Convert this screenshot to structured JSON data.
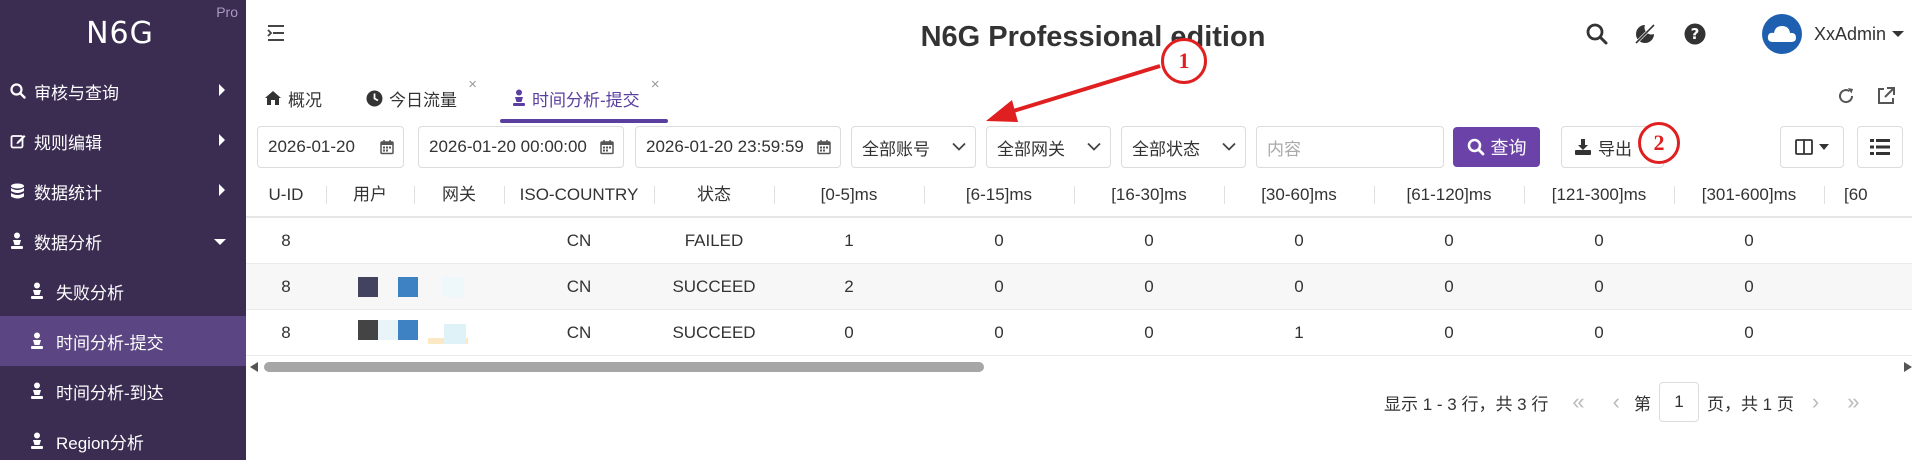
{
  "app": {
    "logo": "N6G",
    "edition_badge": "Pro",
    "title": "N6G Professional edition"
  },
  "sidebar": {
    "items": [
      {
        "label": "审核与查询",
        "icon": "search-icon"
      },
      {
        "label": "规则编辑",
        "icon": "edit-icon"
      },
      {
        "label": "数据统计",
        "icon": "database-icon"
      },
      {
        "label": "数据分析",
        "icon": "user-analysis-icon",
        "expanded": true
      }
    ],
    "sub_items": [
      {
        "label": "失败分析"
      },
      {
        "label": "时间分析-提交",
        "active": true
      },
      {
        "label": "时间分析-到达"
      },
      {
        "label": "Region分析"
      }
    ]
  },
  "header": {
    "username": "XxAdmin"
  },
  "tabs": [
    {
      "label": "概况",
      "icon": "home-icon"
    },
    {
      "label": "今日流量",
      "icon": "clock-icon",
      "closable": true
    },
    {
      "label": "时间分析-提交",
      "icon": "user-analysis-icon",
      "closable": true,
      "active": true
    }
  ],
  "filters": {
    "date": "2026-01-20",
    "start_time": "2026-01-20 00:00:00",
    "end_time": "2026-01-20 23:59:59",
    "account": "全部账号",
    "gateway": "全部网关",
    "status": "全部状态",
    "content_placeholder": "内容",
    "query_label": "查询",
    "export_label": "导出"
  },
  "table": {
    "columns": [
      "U-ID",
      "用户",
      "网关",
      "ISO-COUNTRY",
      "状态",
      "[0-5]ms",
      "[6-15]ms",
      "[16-30]ms",
      "[30-60]ms",
      "[61-120]ms",
      "[121-300]ms",
      "[301-600]ms",
      "[60"
    ],
    "rows": [
      [
        "8",
        "",
        "",
        "CN",
        "FAILED",
        "1",
        "0",
        "0",
        "0",
        "0",
        "0",
        "0",
        ""
      ],
      [
        "8",
        "",
        "",
        "CN",
        "SUCCEED",
        "2",
        "0",
        "0",
        "0",
        "0",
        "0",
        "0",
        ""
      ],
      [
        "8",
        "",
        "",
        "CN",
        "SUCCEED",
        "0",
        "0",
        "0",
        "1",
        "0",
        "0",
        "0",
        ""
      ]
    ]
  },
  "pagination": {
    "summary": "显示 1 - 3 行，共 3 行",
    "page_prefix": "第",
    "current_page": "1",
    "page_suffix": "页，共 1 页"
  },
  "annotations": {
    "marker_1": "1",
    "marker_2": "2"
  },
  "colors": {
    "sidebar_bg": "#3b2c52",
    "sidebar_active": "#5b4683",
    "accent": "#6b42a8",
    "annotation": "#e02020"
  }
}
